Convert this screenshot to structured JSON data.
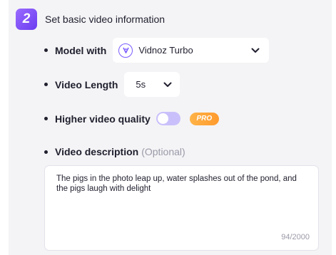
{
  "step": {
    "number": "2",
    "title": "Set basic video information"
  },
  "model": {
    "label": "Model with",
    "selected": "Vidnoz Turbo",
    "icon": "vidnoz-logo-icon"
  },
  "length": {
    "label": "Video Length",
    "selected": "5s"
  },
  "quality": {
    "label": "Higher video quality",
    "enabled": false,
    "badge": "PRO"
  },
  "description": {
    "label": "Video description",
    "optional": "(Optional)",
    "value": "The pigs in the photo leap up, water splashes out of the pond, and the pigs laugh with delight",
    "count": "94/2000"
  },
  "colors": {
    "accent": "#7c5cff",
    "pro": "#ffa63a",
    "panel": "#f4f4f6"
  }
}
